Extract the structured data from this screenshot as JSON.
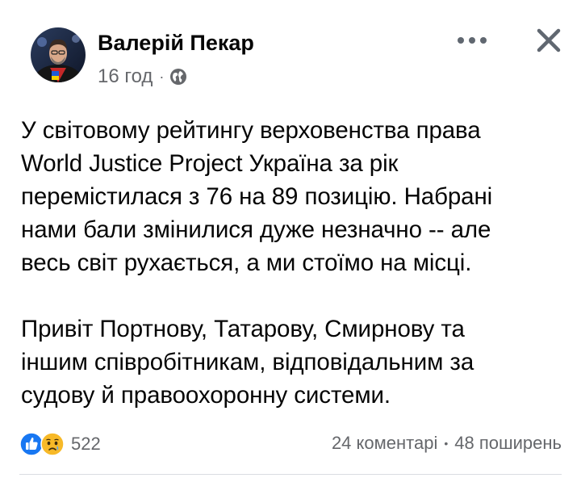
{
  "post": {
    "author": "Валерій Пекар",
    "timestamp": "16 год",
    "privacy_icon": "globe-icon",
    "paragraph_1_lines": [
      "У світовому рейтингу верховенства права",
      "World Justice Project Україна за рік",
      "перемістилася з 76 на 89 позицію. Набрані",
      "нами бали змінилися дуже незначно -- але",
      "весь світ рухається, а ми стоїмо на місці."
    ],
    "paragraph_2_lines": [
      "Привіт Портнову, Татарову, Смирнову та",
      "іншим співробітникам, відповідальним за",
      "судову й правоохоронну системи."
    ]
  },
  "header_actions": {
    "more_icon": "more-horizontal-icon",
    "close_icon": "close-icon"
  },
  "footer": {
    "reaction_icons": [
      "like-icon",
      "sad-icon"
    ],
    "reaction_count": "522",
    "comments": "24 коментарі",
    "separator": "•",
    "shares": "48 поширень"
  },
  "colors": {
    "text_primary": "#050505",
    "text_secondary": "#65676b",
    "like_blue": "#1877f2",
    "sad_yellow": "#f7b928"
  }
}
